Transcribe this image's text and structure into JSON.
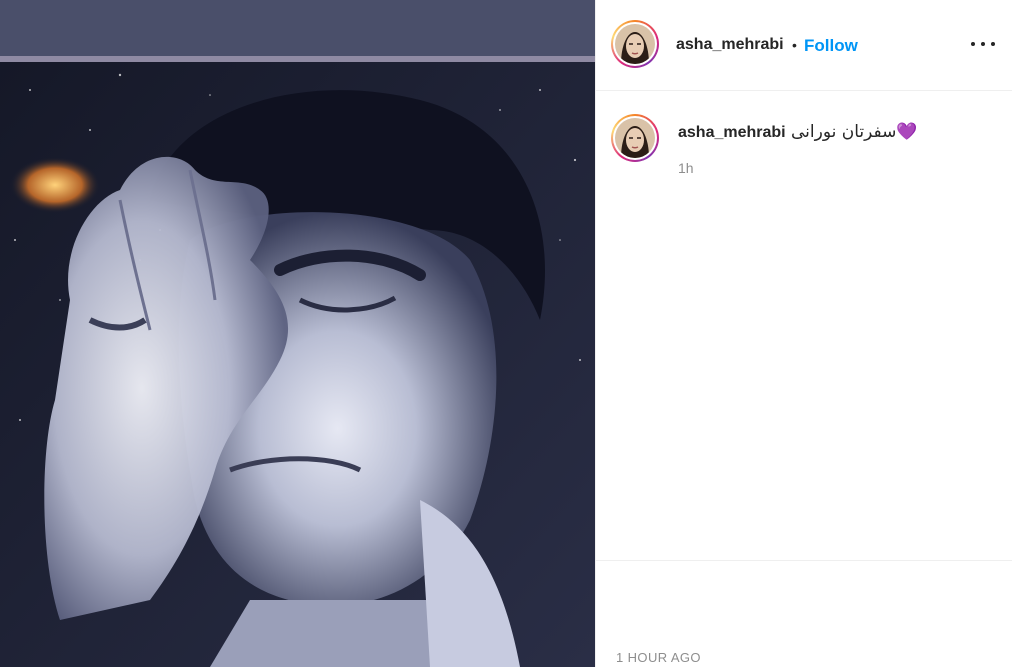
{
  "post": {
    "username": "asha_mehrabi",
    "separator": "•",
    "follow_label": "Follow",
    "more_icon": "more-horizontal-icon",
    "caption": {
      "username": "asha_mehrabi",
      "text": "سفرتان نورانی💜",
      "relative_time": "1h"
    },
    "timestamp": "1 HOUR AGO"
  },
  "colors": {
    "follow": "#0095f6",
    "text": "#262626",
    "muted": "#8e8e8e",
    "divider": "#efefef"
  }
}
